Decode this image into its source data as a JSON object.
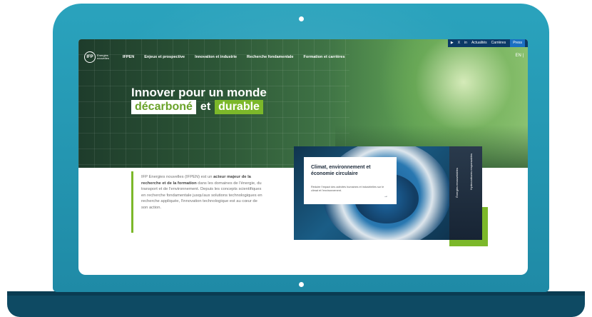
{
  "topbar": {
    "icons": [
      "youtube-icon",
      "x-icon",
      "linkedin-icon"
    ],
    "youtube": "▶",
    "x": "X",
    "linkedin": "in",
    "actualites": "Actualités",
    "carrieres": "Carrières",
    "presse": "Press"
  },
  "nav": {
    "logo_text": "Energies nouvelles",
    "logo_mark": "IFP",
    "items": [
      "IFPEN",
      "Enjeux et prospective",
      "Innovation et industrie",
      "Recherche fondamentale",
      "Formation et carrières"
    ],
    "lang": "EN | "
  },
  "hero": {
    "title": "Innover pour un monde",
    "word1": "décarboné",
    "word2": "et",
    "word3": "durable"
  },
  "intro": {
    "p1": "IFP Energies nouvelles (IFPEN) est un ",
    "bold": "acteur majeur de la recherche et de la formation",
    "p2": " dans les domaines de l'énergie, du transport et de l'environnement. Depuis les concepts scientifiques en recherche fondamentale jusqu'aux solutions technologiques en recherche appliquée, l'innovation technologique est au cœur de son action."
  },
  "card": {
    "title": "Climat, environnement et économie circulaire",
    "desc": "Réduire l'impact des activités humaines et industrielles sur le climat et l'environnement.",
    "arrow": "→",
    "side_label_1": "Hydrocarbures responsables",
    "side_label_2": "Énergies renouvelables"
  },
  "colors": {
    "lid": "#1f8aa6",
    "base": "#0e4a63",
    "accent_green": "#7cb82a",
    "topbar": "#0c3a66"
  }
}
